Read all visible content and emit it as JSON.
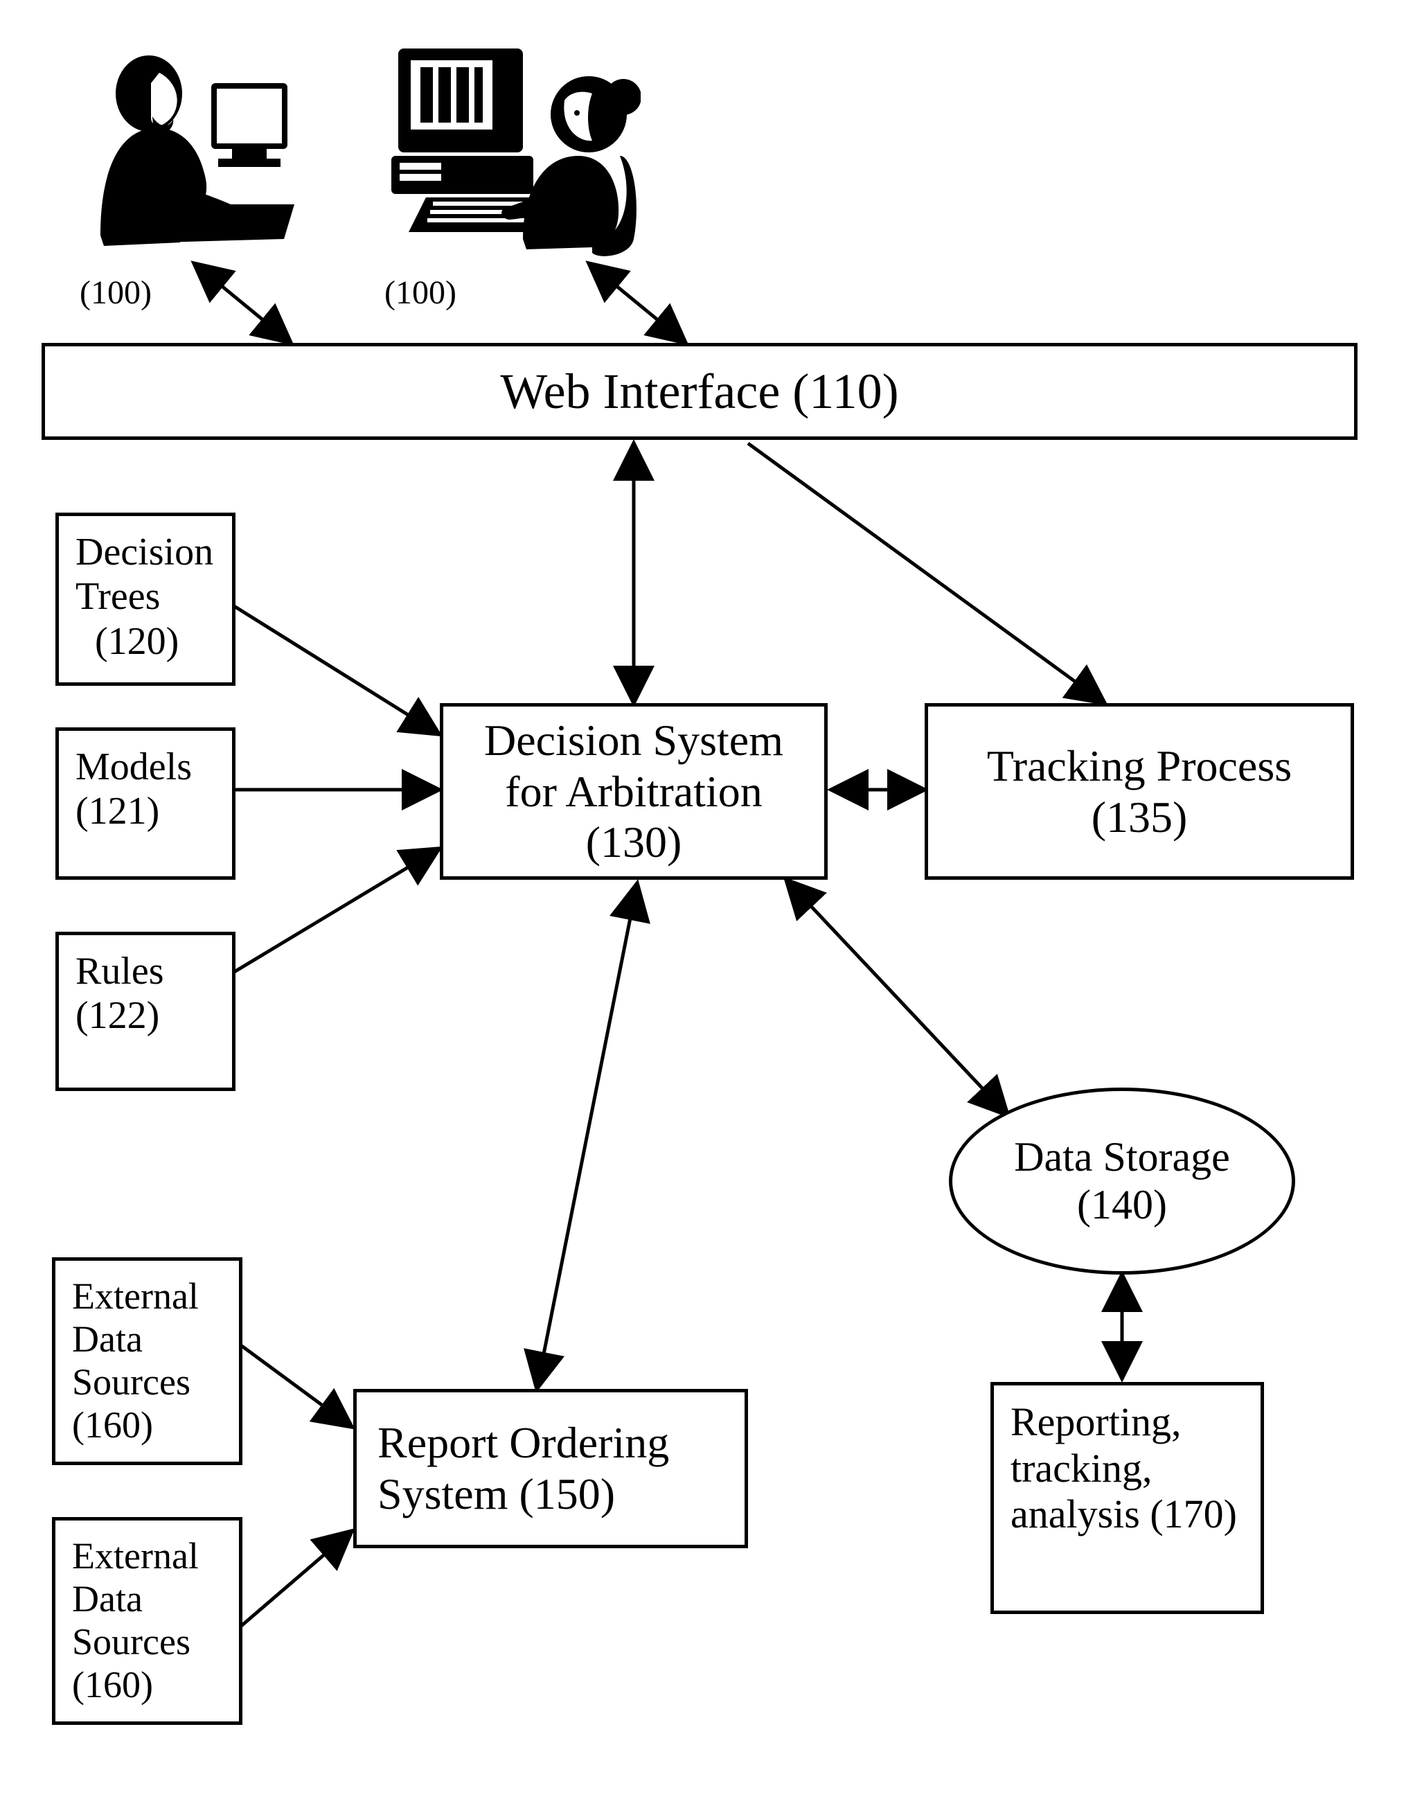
{
  "users": {
    "left_caption": "(100)",
    "right_caption": "(100)"
  },
  "web_interface": {
    "label": "Web Interface (110)"
  },
  "decision_trees": {
    "line1": "Decision",
    "line2": "Trees",
    "line3": "  (120)"
  },
  "models": {
    "line1": "Models",
    "line2": "(121)"
  },
  "rules": {
    "line1": "Rules",
    "line2": "(122)"
  },
  "decision_system": {
    "line1": "Decision System",
    "line2": "for Arbitration",
    "line3": "(130)"
  },
  "tracking_process": {
    "line1": "Tracking Process",
    "line2": "(135)"
  },
  "data_storage": {
    "line1": "Data Storage",
    "line2": "(140)"
  },
  "report_ordering": {
    "line1": "Report Ordering",
    "line2": "System (150)"
  },
  "ext_src_a": {
    "line1": "External",
    "line2": "Data",
    "line3": "Sources",
    "line4": "(160)"
  },
  "ext_src_b": {
    "line1": "External",
    "line2": "Data",
    "line3": "Sources",
    "line4": "(160)"
  },
  "reporting": {
    "line1": "Reporting,",
    "line2": "tracking,",
    "line3": "analysis",
    "line4": "(170)"
  }
}
